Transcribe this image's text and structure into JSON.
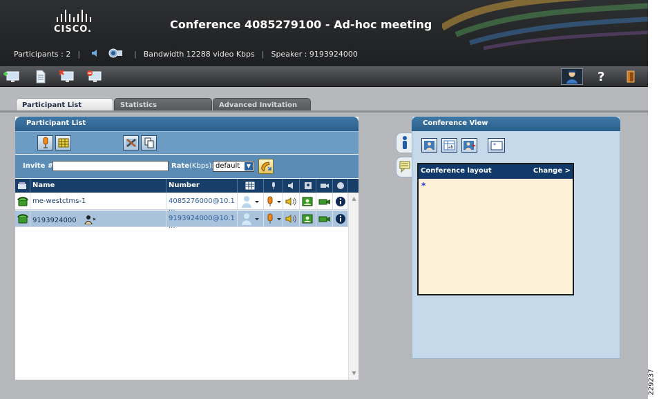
{
  "header": {
    "logo_text": "CISCO.",
    "title": "Conference 4085279100 - Ad-hoc meeting",
    "participants": "Participants : 2",
    "bandwidth": "Bandwidth 12288 video Kbps",
    "speaker": "Speaker : 9193924000"
  },
  "tabs": [
    {
      "label": "Participant List",
      "active": true
    },
    {
      "label": "Statistics",
      "active": false
    },
    {
      "label": "Advanced Invitation",
      "active": false
    }
  ],
  "participant_panel": {
    "title": "Participant List",
    "invite_label": "Invite #:",
    "invite_value": "",
    "rate_label": "Rate",
    "rate_unit": "(Kbps):",
    "rate_value": "default",
    "columns": {
      "name": "Name",
      "number": "Number"
    },
    "rows": [
      {
        "name": "me-westctms-1",
        "number": "4085276000@10.1 ..."
      },
      {
        "name": "9193924000",
        "number": "9193924000@10.1 ..."
      }
    ]
  },
  "conference_view": {
    "title": "Conference View",
    "layout_title": "Conference layout",
    "change_label": "Change >",
    "layout_marker": "*"
  },
  "figure_id": "229237",
  "colors": {
    "header_bg": "#1e1f20",
    "panel_head": "#2b5f8b",
    "table_head": "#173e68",
    "selected_row": "#a9c3dd",
    "layout_bg": "#fdf1d8"
  }
}
